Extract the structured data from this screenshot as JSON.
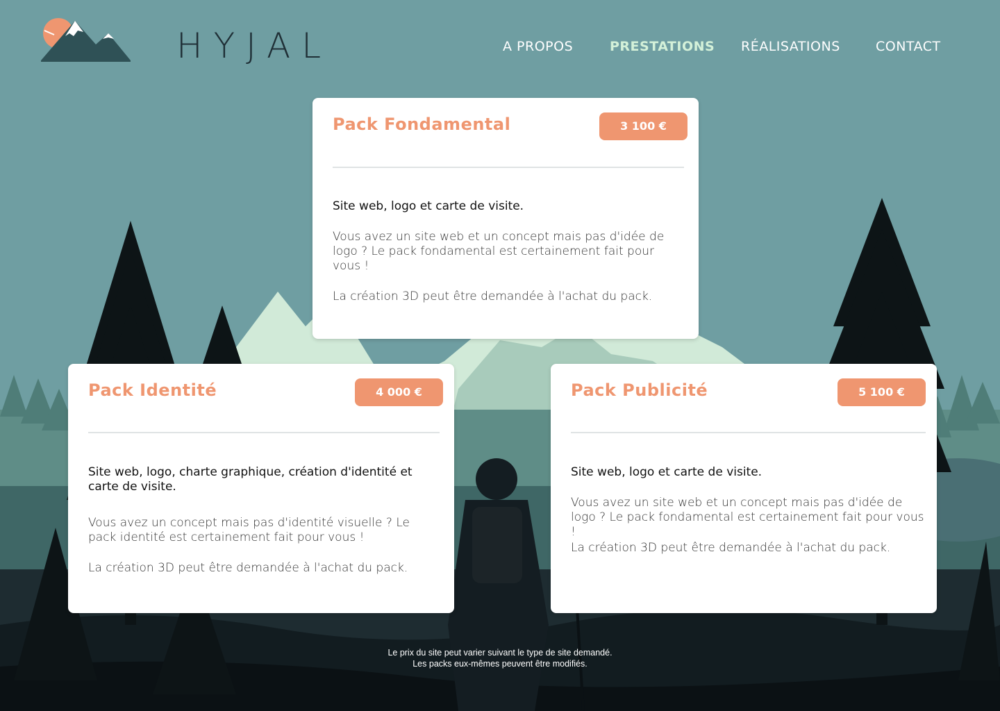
{
  "brand": {
    "name": "HYJAL"
  },
  "nav": [
    {
      "label": "A PROPOS"
    },
    {
      "label": "PRESTATIONS",
      "active": true
    },
    {
      "label": "RÉALISATIONS"
    },
    {
      "label": "CONTACT"
    }
  ],
  "packs": [
    {
      "title": "Pack Fondamental",
      "price": "3 100 €",
      "subtitle": "Site web, logo et carte de visite.",
      "desc1": "Vous avez un site web et un concept mais pas d'idée de logo ? Le pack fondamental est certainement fait pour vous !",
      "desc2": "La création 3D peut être demandée à l'achat du pack."
    },
    {
      "title": "Pack Identité",
      "price": "4 000 €",
      "subtitle": "Site web, logo, charte graphique, création d'identité et carte de visite.",
      "desc1": "Vous avez un concept mais pas d'identité visuelle ? Le pack identité est certainement fait pour vous !",
      "desc2": "La création 3D peut être demandée à l'achat du pack."
    },
    {
      "title": "Pack Publicité",
      "price": "5 100 €",
      "subtitle": "Site web, logo et carte de visite.",
      "desc1": "Vous avez un site web et un concept mais pas d'idée de logo ? Le pack fondamental est certainement fait pour vous !",
      "desc2": "La création 3D peut être demandée à l'achat du pack."
    }
  ],
  "footnote": {
    "line1": "Le prix du site peut varier suivant le type de site demandé.",
    "line2": "Les packs eux-mêmes peuvent être modifiés."
  },
  "colors": {
    "accent": "#ef9670",
    "nav_active": "#d4f1d9",
    "sky": "#6f9ea2"
  }
}
